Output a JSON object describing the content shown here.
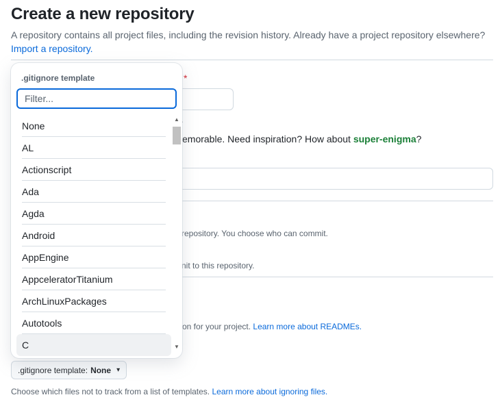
{
  "header": {
    "title": "Create a new repository",
    "subtitle": "A repository contains all project files, including the revision history. Already have a project repository elsewhere?",
    "import_link": "Import a repository."
  },
  "background": {
    "required_star": "*",
    "dot": ".",
    "name_hint_prefix": "emorable. Need inspiration? How about ",
    "name_hint_suggestion": "super-enigma",
    "name_hint_suffix": "?",
    "public_desc": "repository. You choose who can commit.",
    "private_desc": "nit to this repository.",
    "readme_prefix": "on for your project. ",
    "readme_link": "Learn more about READMEs."
  },
  "gitignore": {
    "button_label_prefix": ".gitignore template: ",
    "button_value": "None",
    "caret": "▾",
    "help_text": "Choose which files not to track from a list of templates. ",
    "help_link": "Learn more about ignoring files."
  },
  "dropdown": {
    "header": ".gitignore template",
    "filter_placeholder": "Filter...",
    "filter_value": "",
    "items": [
      "None",
      "AL",
      "Actionscript",
      "Ada",
      "Agda",
      "Android",
      "AppEngine",
      "AppceleratorTitanium",
      "ArchLinuxPackages",
      "Autotools",
      "C"
    ],
    "hovered_item": "C",
    "scroll_up": "▲",
    "scroll_down": "▼"
  },
  "colors": {
    "accent": "#0969da",
    "success": "#1a7f37",
    "border": "#d1d9e0",
    "hover": "#eff1f3"
  }
}
